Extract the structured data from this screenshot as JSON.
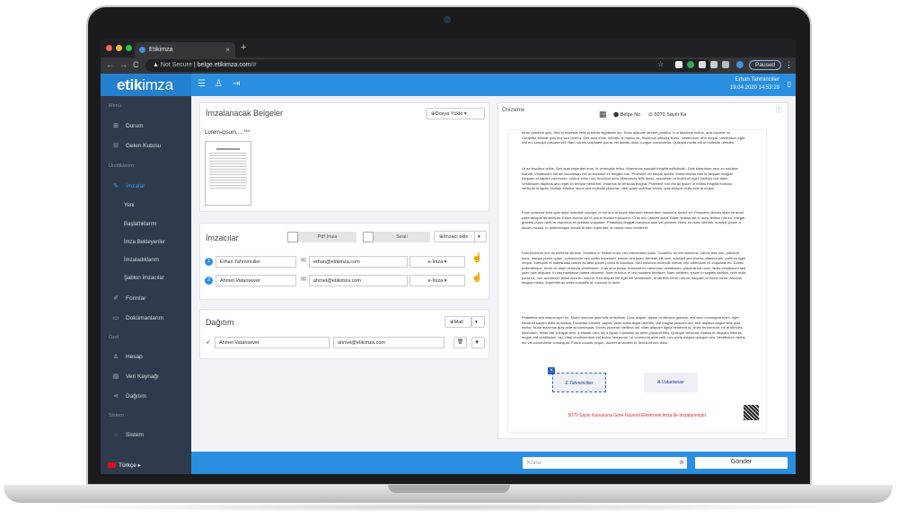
{
  "browser": {
    "tab_title": "Etikimza",
    "tab_close": "×",
    "new_tab": "+",
    "nav_back": "←",
    "nav_forward": "→",
    "reload": "C",
    "not_secure": "Not Secure",
    "url_host": "belge.etikimza.com",
    "url_path": "/#",
    "paused_label": "Paused",
    "menu": "⋮"
  },
  "app": {
    "logo_bold": "etik",
    "logo_thin": "imza",
    "user_name": "Erhan Tahmincilier",
    "user_datetime": "19.04.2020 14:53:29"
  },
  "sidebar": {
    "section_menu": "Menü",
    "section_urettikim": "Ürettiklerim",
    "section_ozel": "Özel",
    "section_sistem": "Sistem",
    "durum": "Durum",
    "gelen": "Gelen Kutusu",
    "imzalar": "İmzalar",
    "yeni": "Yeni",
    "baslatiklarim": "Başlattıklarım",
    "imza_bekleyenler": "İmza Bekleyenler",
    "imzaladiklarim": "İmzaladıklarım",
    "sablon": "Şablon İmzacılar",
    "formlar": "Formlar",
    "dokumanlarim": "Dokümanlarım",
    "hesap": "Hesap",
    "veri": "Veri Kaynağı",
    "dagitim": "Dağıtım",
    "sistem": "Sistem",
    "lang": "Türkçe ▸"
  },
  "belgeler": {
    "title": "İmzalanacak Belgeler",
    "upload": "Dosya Yükle",
    "doc_name": "Lorem-ipsum.....***"
  },
  "imzacilar": {
    "title": "İmzacılar",
    "pdf_label": "Pdf İmza",
    "sirali_label": "Sıralı",
    "add_label": "İmzacı ekle",
    "rows": [
      {
        "num": "1",
        "name": "Erhan Tahmincilier",
        "email": "erhan@etikimza.com",
        "type": "e-İmza ▾"
      },
      {
        "num": "2",
        "name": "Ahmet Vatansever",
        "email": "ahmet@etikimza.com",
        "type": "e-İmza ▾"
      }
    ]
  },
  "dagitim": {
    "title": "Dağıtım",
    "mail_btn": "Mail",
    "name": "Ahmet Vatansever",
    "email": "ahmet@etikimza.com"
  },
  "preview": {
    "title": "Önizleme",
    "belge_no": "Belge No",
    "sayili": "5070 Sayılı Ka",
    "footer": "5070 Sayılı Kanununa Göre Güvenli Elektronik İmza İle İmzalanmıştır",
    "sig1": "E.Tahmincilier",
    "sig2": "A.Vatansever",
    "paragraphs": [
      "tortor placerat quis. Sed id molestie velit, pulvinar dignissim leo. Nunc aliquam laoreet porttitor. In a faucibus metus, quis lobortis mi. Curabitur blandit quis orci sed viverra. Sed arcu enim, lobortis id massa ac, maximus ultricies libero. Vestibulum nibh neque, vestibulum eget nisl eu, suscipit posuere elit. Nam rutrum vulputate purus, vel iaculis dolor congue consectetur. Quisque mollis elit ut molestie ultricies.",
      "Ut ac faucibus tellus. Sed quis imperdiet eros, in venenatis tellus. Maecenas suscipit fringilla sollicitudin. Duis bibendum arcu eu sodales blandit. Vestibulum rutrum accumsan elit, at tincidunt ex fringilla non. Praesent vel neque iaculis. Morbi lacinia velit id aliquam feugiat. Aliquam et sapien commodo, cursus enim non, tincidunt sem. Maecenas felis lacus, accumsan et tincidunt eget, facilisis nec diam. Vestibulum dapibus arcu eget ex tempor hendrerit. Vivamus id vehicula magna. Praesent non est ac ipsum ut metus fringilla rhoncus vehicula ut ligula. Nullam efficitur, lacus sed molestie placerat, nibh quam pulvinar lectus, quis semper nulla erat at neque.",
      "Proin pharetra eros quis dolor molestie suscipit. In vel orci at turpis interdum elementum maximus auctor ex. Praesent ultrices diam sit amet pellentesque fermentum. Etiam lacinia dui id purus tincidunt posuere. Cras nec ultrices diam. Etiam finibus est in nunc finibus rutrum. Integer gravida purus nibh, at maximus ex pretium vulputate. Phasellus feugiat maximus arcu vel pretium. Nunc eu nunc lobortis, suscipit ipsum a, iaculis massa. In pellentesque iaculis id nibh imperdiet, at varius nunc hendrerit.",
      "Duis tincidunt orci ac eleifend ultrices. Vivamus in finibus enim, nec elementum justo. Curabitur ac est maximus, varius felis nec, placerat risus. Integer purus quam, consectetur nec mollis imperdiet, rutrum sed justo. Aenean elit sem, suscipit sed viverra ullamcorper, pretium eget neque. Interdum et malesuada fames ac ante ipsum primis in faucibus. Sed euismod molestie metus, nec bibendum ex vulputate eu. Donec pellentesque, tortor ac diam vehicula vestibulum. Cras arcu purus, tincidunt eu commodo vestibulum, placerat vel nunc. Nulla vestibulum sed justo quis aliquam. In hac habitasse platea dictumst. Nam in lacus et orci sodales tincidunt. Nam eleifend, ipsum in sagittis facilisis, nibh nulla porta mi, non accumsan tellus arcu eu mauris. Sed aliquet elit eget elit vestibulum, et ultrices tortor rutrum. Aliquam et lorem tortor. Aenean magna metus, imperdiet ac amet convallis id, rhoncus id dolor.",
      "Phasellus sed ullamcorper mi. Morbi rhoncus quis felis ut facilisis. Cras aliquet, ipsum ut ultricies gravida, orci arcu consequat enim, eget tincidunt sapien nulla at massa. Curabitur lobortis, sapien vitae scelerisque ultricies, nisl magna posuere dui, sed dapibus augue felis quis lectus. Nulla maximus quis ante at consequat. Donec placerat eleifend dui, vitae aliquam ligula hendrerit id. Nunc fermentum, mi at ultricies bibendum, tellus nisl volutpat sem, a blandit urna dui a ligula. Curabitur sit amet placerat felis. Quisque vehicula, massa et aliquam lobortis, augue nisl vestibulum nisl, vitae condimentum est lectus nec purus. Ut commodo ante velit, nec porta magna quisque sed. Vestibulum varius leo vel consectetur consequat. Fusce mauris neque, laoreet at laoreet id, tincidunt nec dolor."
    ]
  },
  "bottom": {
    "konu_placeholder": "Konu",
    "gonder": "Gönder"
  },
  "colors": {
    "brand": "#2a8fe0",
    "sidebar": "#2f3b4c",
    "footer_red": "#d9272e"
  }
}
